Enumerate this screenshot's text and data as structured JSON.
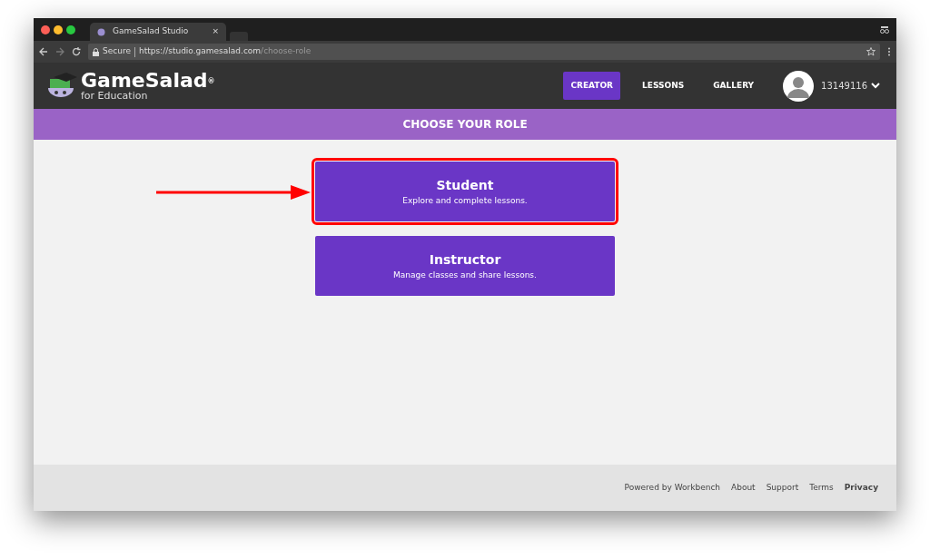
{
  "browser": {
    "tab_title": "GameSalad Studio",
    "tab_close": "×",
    "security": "Secure",
    "url_host": "https://studio.gamesalad.com",
    "url_path": "/choose-role"
  },
  "header": {
    "logo_title": "GameSalad",
    "logo_mark": "®",
    "logo_subtitle": "for Education",
    "nav": [
      {
        "label": "CREATOR",
        "selected": true
      },
      {
        "label": "LESSONS",
        "selected": false
      },
      {
        "label": "GALLERY",
        "selected": false
      }
    ],
    "username": "13149116"
  },
  "banner": {
    "title": "CHOOSE YOUR ROLE"
  },
  "roles": [
    {
      "title": "Student",
      "description": "Explore and complete lessons.",
      "highlighted": true
    },
    {
      "title": "Instructor",
      "description": "Manage classes and share lessons.",
      "highlighted": false
    }
  ],
  "footer": {
    "links": [
      {
        "label": "Powered by Workbench",
        "emphasized": false
      },
      {
        "label": "About",
        "emphasized": false
      },
      {
        "label": "Support",
        "emphasized": false
      },
      {
        "label": "Terms",
        "emphasized": false
      },
      {
        "label": "Privacy",
        "emphasized": true
      }
    ]
  }
}
